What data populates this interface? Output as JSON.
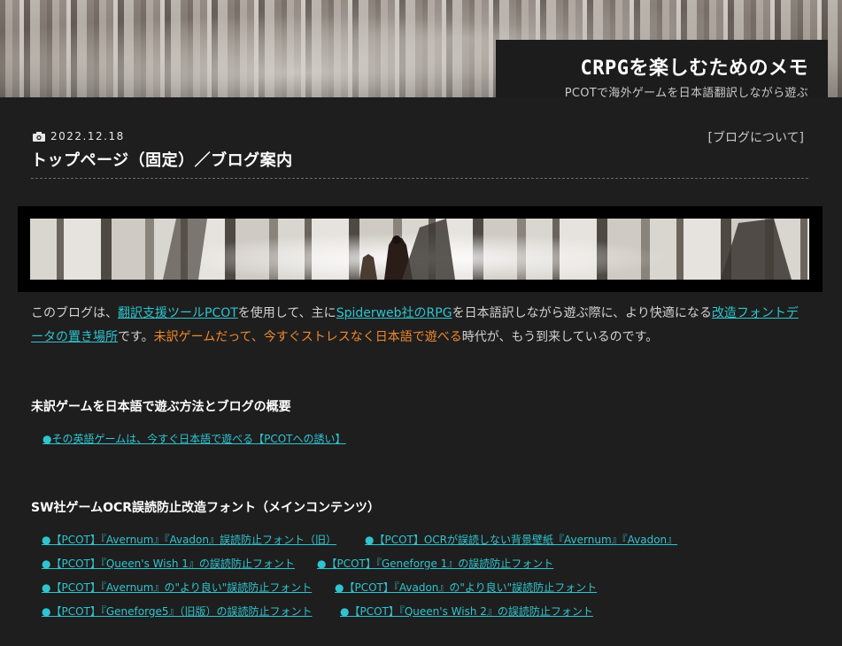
{
  "header": {
    "title": "CRPGを楽しむためのメモ",
    "subtitle": "PCOTで海外ゲームを日本語翻訳しながら遊ぶ"
  },
  "post": {
    "date": "2022.12.18",
    "camera_icon": "camera-icon",
    "title": "トップページ（固定）／ブログ案内",
    "about_link": "[ブログについて]"
  },
  "intro": {
    "t1": "このブログは、",
    "link1": "翻訳支援ツールPCOT",
    "t2": "を使用して、主に",
    "link2": "Spiderweb社のRPG",
    "t3": "を日本語訳しながら遊ぶ際に、より快適になる",
    "link3": "改造フォントデータの置き場所",
    "t4": "です。",
    "highlight": "未訳ゲームだって、今すぐストレスなく日本語で遊べる",
    "t5": "時代が、もう到来しているのです。"
  },
  "section1": {
    "heading": "未訳ゲームを日本語で遊ぶ方法とブログの概要",
    "links": [
      "●その英語ゲームは、今すぐ日本語で遊べる【PCOTへの誘い】"
    ]
  },
  "section2": {
    "heading": "SW社ゲームOCR誤読防止改造フォント（メインコンテンツ）",
    "links": [
      "●【PCOT】『Avernum』『Avadon』誤読防止フォント（旧）",
      "●【PCOT】OCRが誤読しない背景壁紙『Avernum』『Avadon』",
      "●【PCOT】『Queen's Wish 1』の誤読防止フォント",
      "●【PCOT】『Geneforge 1』の誤読防止フォント",
      "●【PCOT】『Avernum』の\"より良い\"誤読防止フォント",
      "●【PCOT】『Avadon』の\"より良い\"誤読防止フォント",
      "●【PCOT】『Geneforge5』（旧版）の誤読防止フォント",
      "●【PCOT】『Queen's Wish 2』の誤読防止フォント"
    ]
  }
}
